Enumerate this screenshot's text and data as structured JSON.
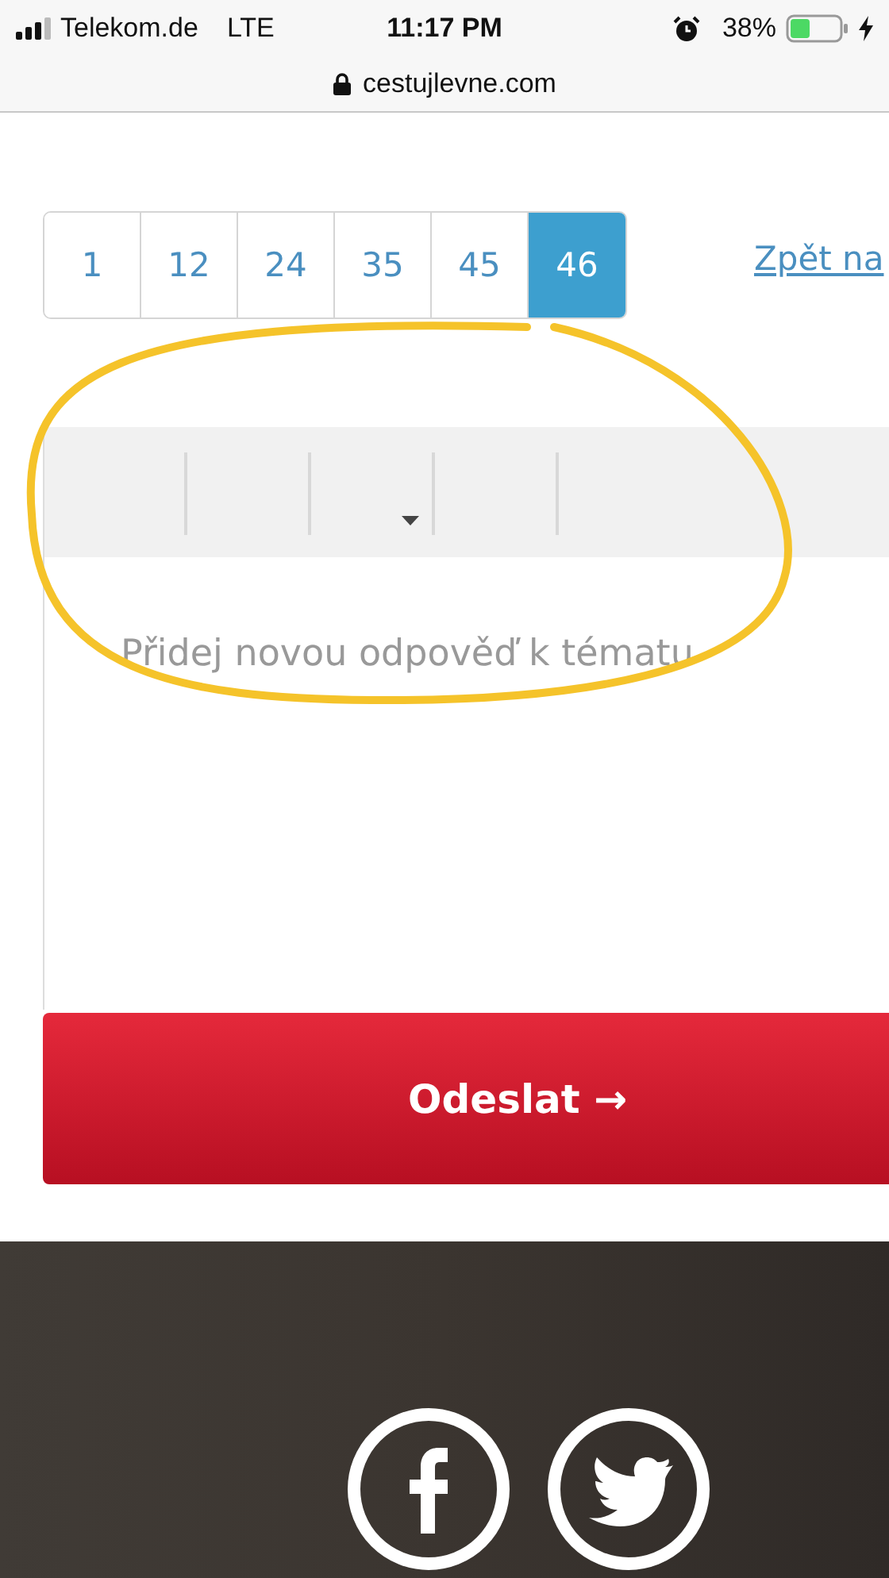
{
  "status_bar": {
    "carrier": "Telekom.de",
    "network": "LTE",
    "time": "11:17 PM",
    "battery": "38%"
  },
  "address_bar": {
    "url": "cestujlevne.com"
  },
  "pagination": {
    "pages": [
      {
        "label": "1",
        "selected": false
      },
      {
        "label": "12",
        "selected": false
      },
      {
        "label": "24",
        "selected": false
      },
      {
        "label": "35",
        "selected": false
      },
      {
        "label": "45",
        "selected": false
      },
      {
        "label": "46",
        "selected": true
      }
    ]
  },
  "back_link": "Zpět na",
  "editor": {
    "toolbar": [
      {
        "kind": "plain"
      },
      {
        "kind": "plain"
      },
      {
        "kind": "dropdown"
      },
      {
        "kind": "plain"
      },
      {
        "kind": "plain"
      }
    ],
    "placeholder": "Přidej novou odpověď k tématu"
  },
  "submit_button": {
    "label": "Odeslat →"
  }
}
